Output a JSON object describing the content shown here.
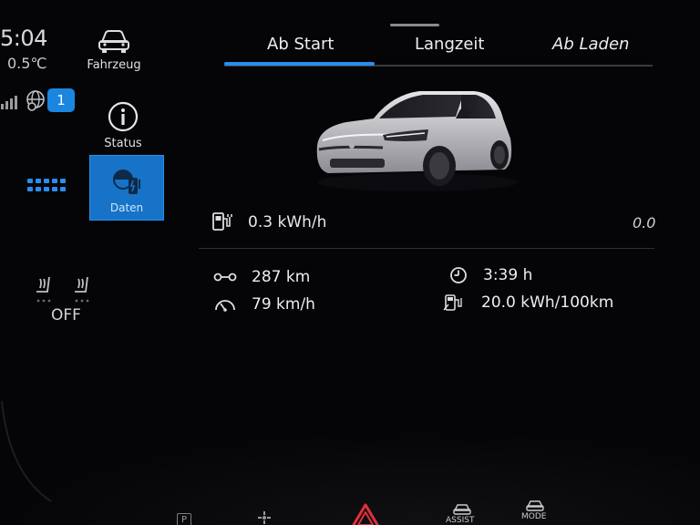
{
  "status_bar": {
    "time": "5:04",
    "temperature": "0.5℃",
    "notification_count": "1"
  },
  "side_menu": {
    "items": [
      {
        "label": "Fahrzeug",
        "icon": "car-icon"
      },
      {
        "label": "Status",
        "icon": "info-icon"
      },
      {
        "label": "Daten",
        "icon": "charging-data-icon",
        "selected": true
      }
    ]
  },
  "seat_heating": {
    "status": "OFF"
  },
  "tabs": [
    {
      "label": "Ab Start",
      "active": true
    },
    {
      "label": "Langzeit",
      "active": false
    },
    {
      "label": "Ab Laden",
      "active": false
    }
  ],
  "consumption": {
    "value": "0.3 kWh/h",
    "right_value": "0.0"
  },
  "stats": {
    "distance": "287 km",
    "avg_speed": "79 km/h",
    "duration": "3:39 h",
    "avg_consumption": "20.0 kWh/100km"
  },
  "bottom_bar": {
    "park_label": "P",
    "assist_label": "ASSIST",
    "mode_label": "MODE"
  },
  "colors": {
    "accent": "#2a8df0",
    "selected_bg": "#1673c8",
    "hazard": "#e0303a",
    "background": "#050507"
  }
}
